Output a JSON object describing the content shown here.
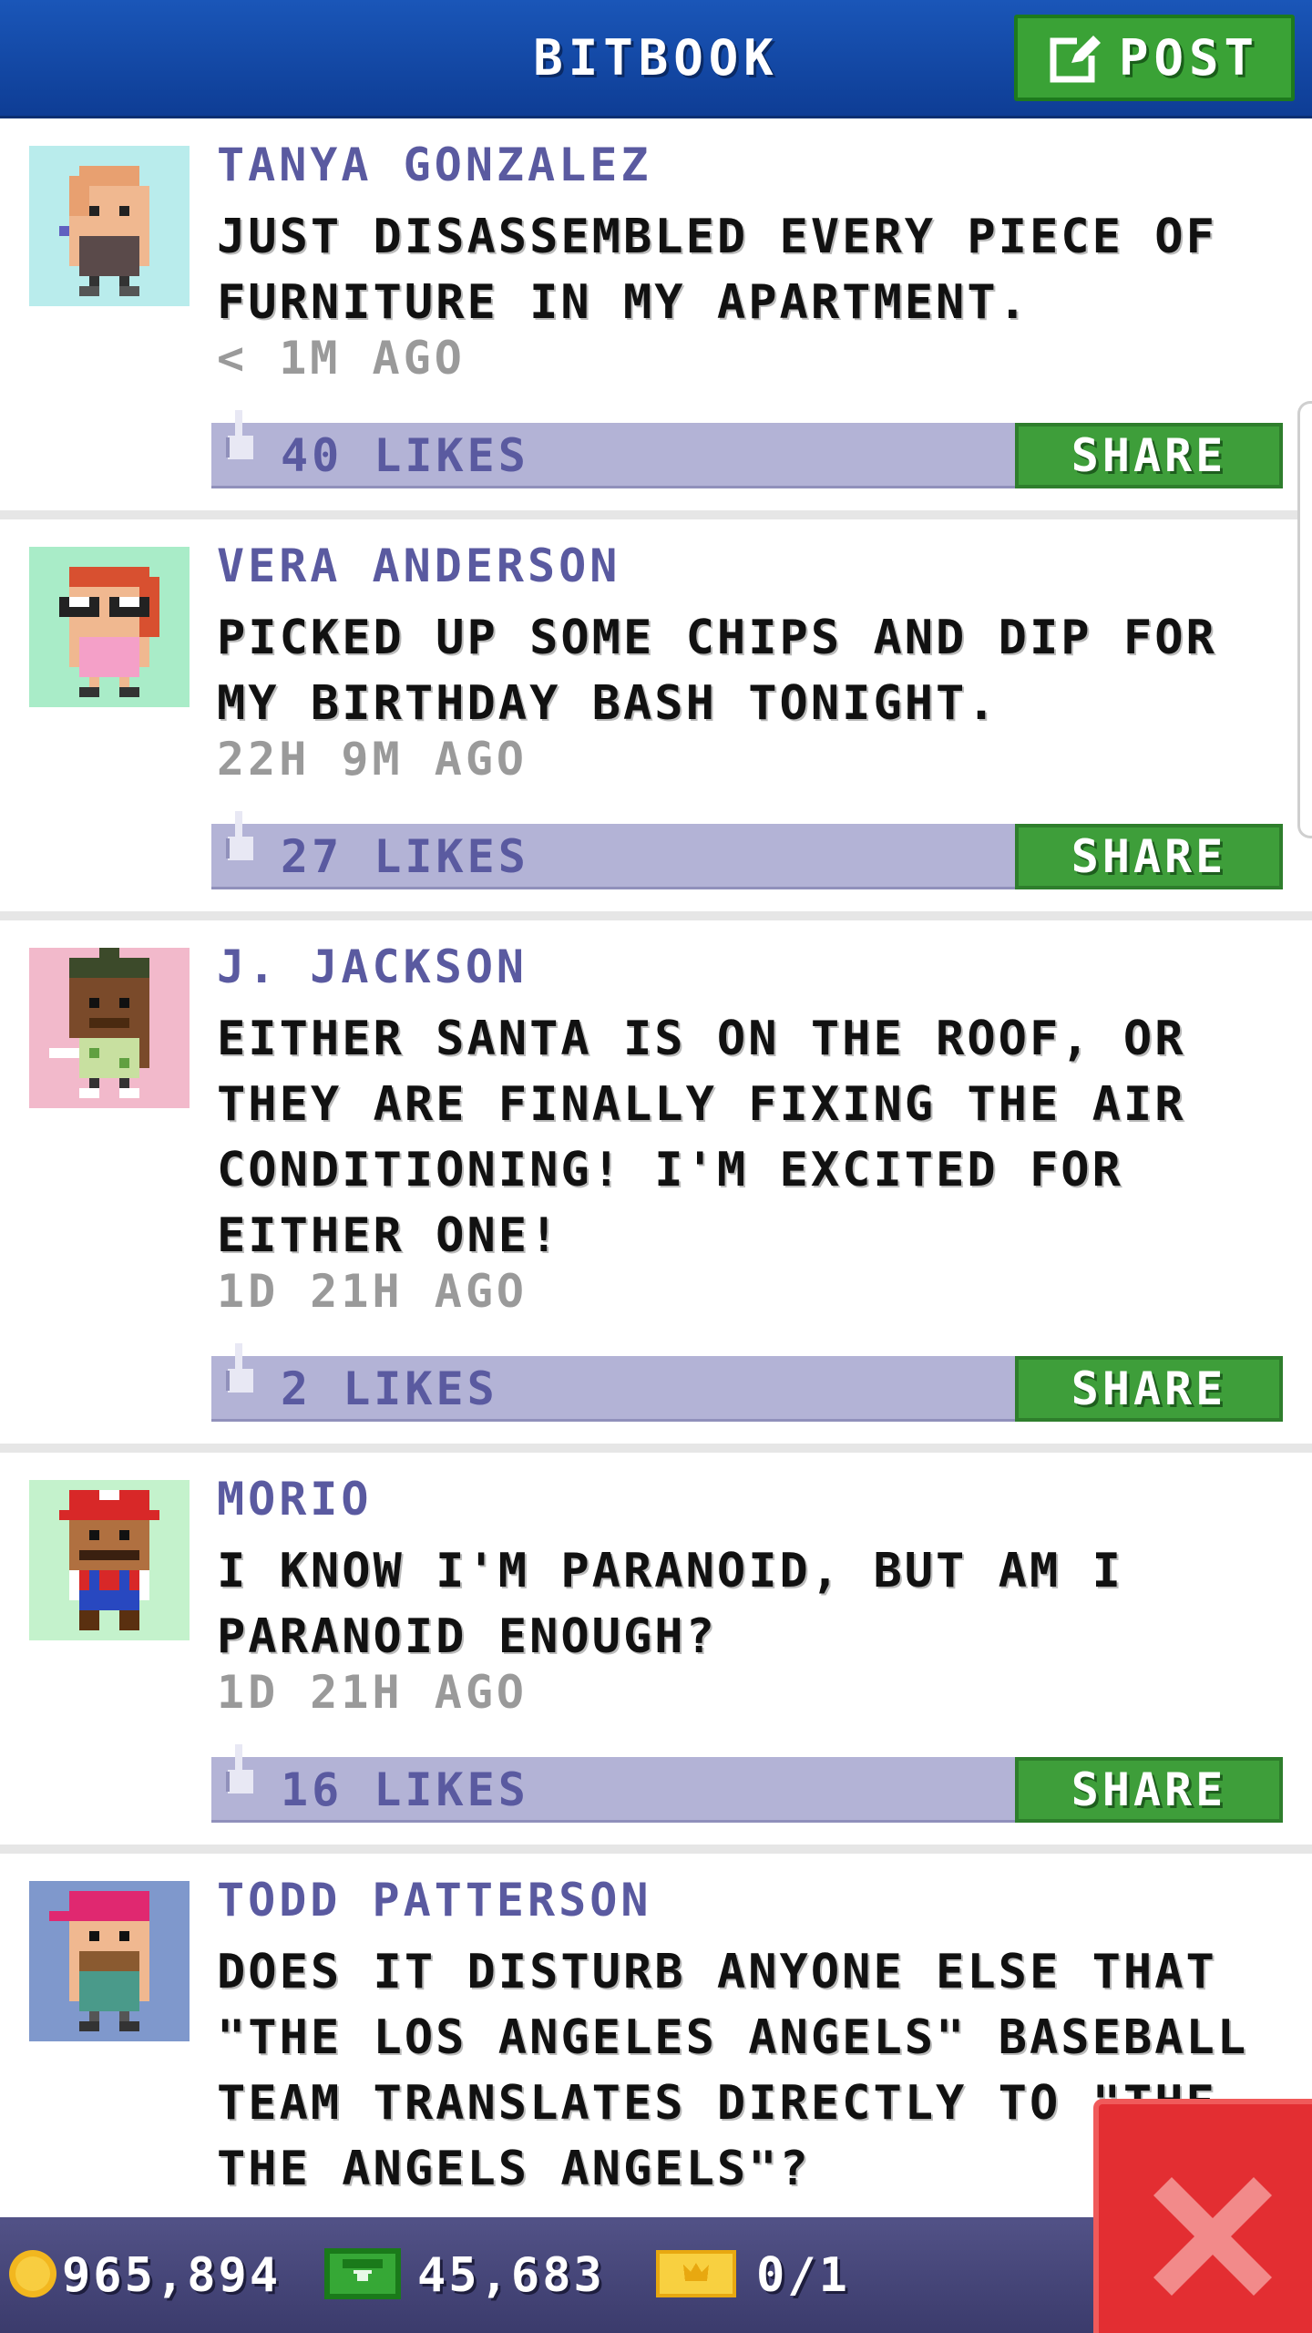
{
  "header": {
    "title": "BITBOOK",
    "post_label": "POST",
    "post_icon": "edit-icon"
  },
  "posts": [
    {
      "author": "TANYA GONZALEZ",
      "message": "JUST DISASSEMBLED EVERY PIECE OF FURNITURE IN MY APARTMENT.",
      "time": "< 1M AGO",
      "likes": "40 LIKES",
      "share_label": "SHARE",
      "avatar_bg": "#b9ecec"
    },
    {
      "author": "VERA ANDERSON",
      "message": "PICKED UP SOME CHIPS AND DIP FOR MY BIRTHDAY BASH TONIGHT.",
      "time": "22H 9M AGO",
      "likes": "27 LIKES",
      "share_label": "SHARE",
      "avatar_bg": "#a9ecc8"
    },
    {
      "author": "J. JACKSON",
      "message": "EITHER SANTA IS ON THE ROOF, OR THEY ARE FINALLY FIXING THE AIR CONDITIONING! I'M EXCITED FOR EITHER ONE!",
      "time": "1D 21H AGO",
      "likes": "2 LIKES",
      "share_label": "SHARE",
      "avatar_bg": "#f2b9cb"
    },
    {
      "author": "MORIO",
      "message": "I KNOW I'M PARANOID, BUT AM I PARANOID ENOUGH?",
      "time": "1D 21H AGO",
      "likes": "16 LIKES",
      "share_label": "SHARE",
      "avatar_bg": "#c4f2cc"
    },
    {
      "author": "TODD PATTERSON",
      "message": "DOES IT DISTURB ANYONE ELSE THAT \"THE LOS ANGELES ANGELS\" BASEBALL TEAM TRANSLATES DIRECTLY TO \"THE THE ANGELS ANGELS\"?",
      "avatar_bg": "#7f98cc"
    }
  ],
  "bottom_bar": {
    "coins": "965,894",
    "bux": "45,683",
    "tickets": "0/1",
    "coin_icon": "coin-icon",
    "bux_icon": "bux-icon",
    "ticket_icon": "vip-ticket-icon"
  },
  "close_icon": "close-icon",
  "colors": {
    "header_blue": "#1a56b8",
    "share_green": "#3e9e3a",
    "likes_bar": "#b3b3d6",
    "author_purple": "#5a5aa0",
    "close_red": "#e32e32"
  }
}
